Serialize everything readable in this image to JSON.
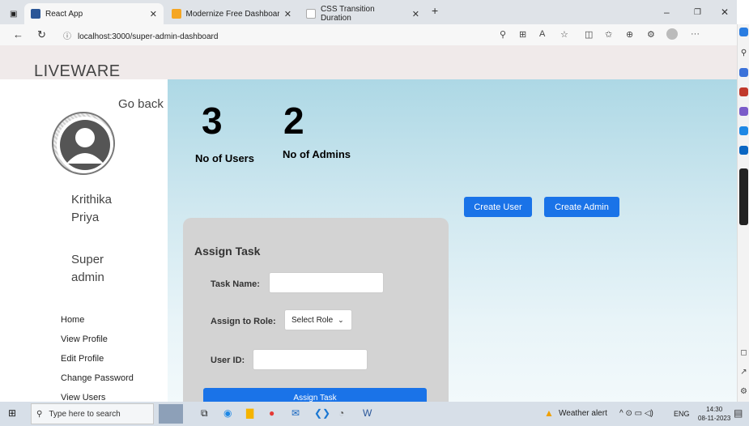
{
  "browser": {
    "tabs": [
      {
        "title": "React App",
        "active": true,
        "favicon_color": "#2b5797"
      },
      {
        "title": "Modernize Free Dashboard Desi",
        "active": false,
        "favicon_color": "#f5a623"
      },
      {
        "title": "CSS Transition Duration",
        "active": false,
        "favicon_color": "#cccccc"
      }
    ],
    "url": "localhost:3000/super-admin-dashboard"
  },
  "app": {
    "logo": "LIVEWARE",
    "sidebar": {
      "go_back": "Go back",
      "user_name": "Krithika Priya",
      "user_role": "Super admin",
      "nav": [
        "Home",
        "View Profile",
        "Edit Profile",
        "Change Password",
        "View Users"
      ]
    },
    "stats": [
      {
        "value": "3",
        "label": "No of Users"
      },
      {
        "value": "2",
        "label": "No of Admins"
      }
    ],
    "buttons": {
      "create_user": "Create User",
      "create_admin": "Create Admin"
    },
    "assign_task": {
      "title": "Assign Task",
      "task_name_label": "Task Name:",
      "task_name_value": "",
      "role_label": "Assign to Role:",
      "role_selected": "Select Role",
      "user_id_label": "User ID:",
      "user_id_value": "",
      "submit": "Assign Task"
    },
    "colors": {
      "accent": "#1a73e8",
      "header_bg": "#f0eaea",
      "card_bg": "#d3d3d3",
      "main_bg": "#add8e5"
    }
  },
  "taskbar": {
    "search_placeholder": "Type here to search",
    "weather": "Weather alert",
    "lang": "ENG",
    "time": "14:30",
    "date": "08-11-2023"
  }
}
